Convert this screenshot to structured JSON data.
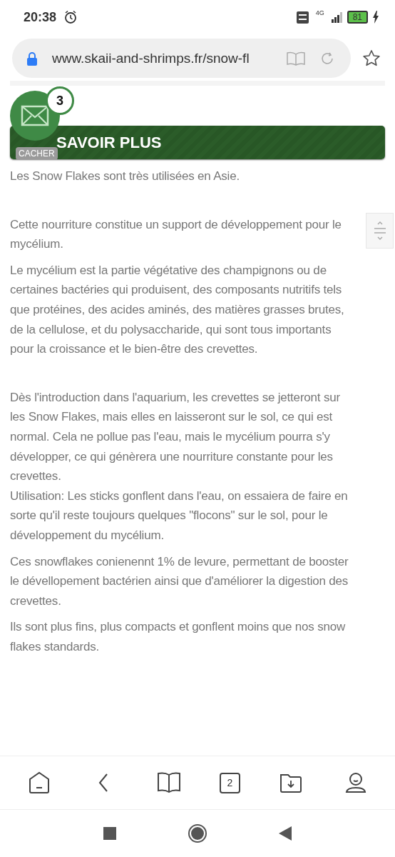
{
  "status_bar": {
    "time": "20:38",
    "network": "4G",
    "battery": "81"
  },
  "address_bar": {
    "url": "www.skaii-and-shrimps.fr/snow-fl"
  },
  "mail_bubble": {
    "count": "3",
    "hide_label": "CACHER"
  },
  "section_heading": "SAVOIR PLUS",
  "paragraphs": [
    {
      "kind": "para",
      "text": "Les Snow Flakes sont très utilisées en Asie."
    },
    {
      "kind": "after_break",
      "text": "Cette nourriture constitue un support de développement pour le mycélium."
    },
    {
      "kind": "para",
      "text": "Le mycélium est la partie végétative des champignons ou de certaines bactéries qui produisent, des composants nutritifs tels que protéines, des acides aminés, des matières grasses brutes, de la cellulose, et du polysaccharide, qui sont tous importants pour la croissance et le bien-être des crevettes."
    },
    {
      "kind": "after_break",
      "text": "Dès l'introduction dans l'aquarium, les crevettes se jetteront sur les Snow Flakes, mais elles en laisseront sur le sol, ce qui est normal. Cela ne pollue pas l'eau, mais le mycélium pourra s'y développer, ce qui génèrera une nourriture constante pour les crevettes."
    },
    {
      "kind": "continuation",
      "text": "Utilisation: Les sticks gonflent dans l'eau, on essaiera de faire en sorte qu'il reste toujours quelques \"flocons\" sur le sol, pour le développement du mycélium."
    },
    {
      "kind": "para",
      "text": "Ces snowflakes conienennt 1% de levure, permettant de booster le dévellopement bactérien ainsi que d'améliorer la digestion des crevettes."
    },
    {
      "kind": "para",
      "text": "Ils sont plus fins, plus compacts et gonflent moins que nos snow flakes standards."
    }
  ],
  "bottom_toolbar": {
    "tab_count": "2"
  }
}
